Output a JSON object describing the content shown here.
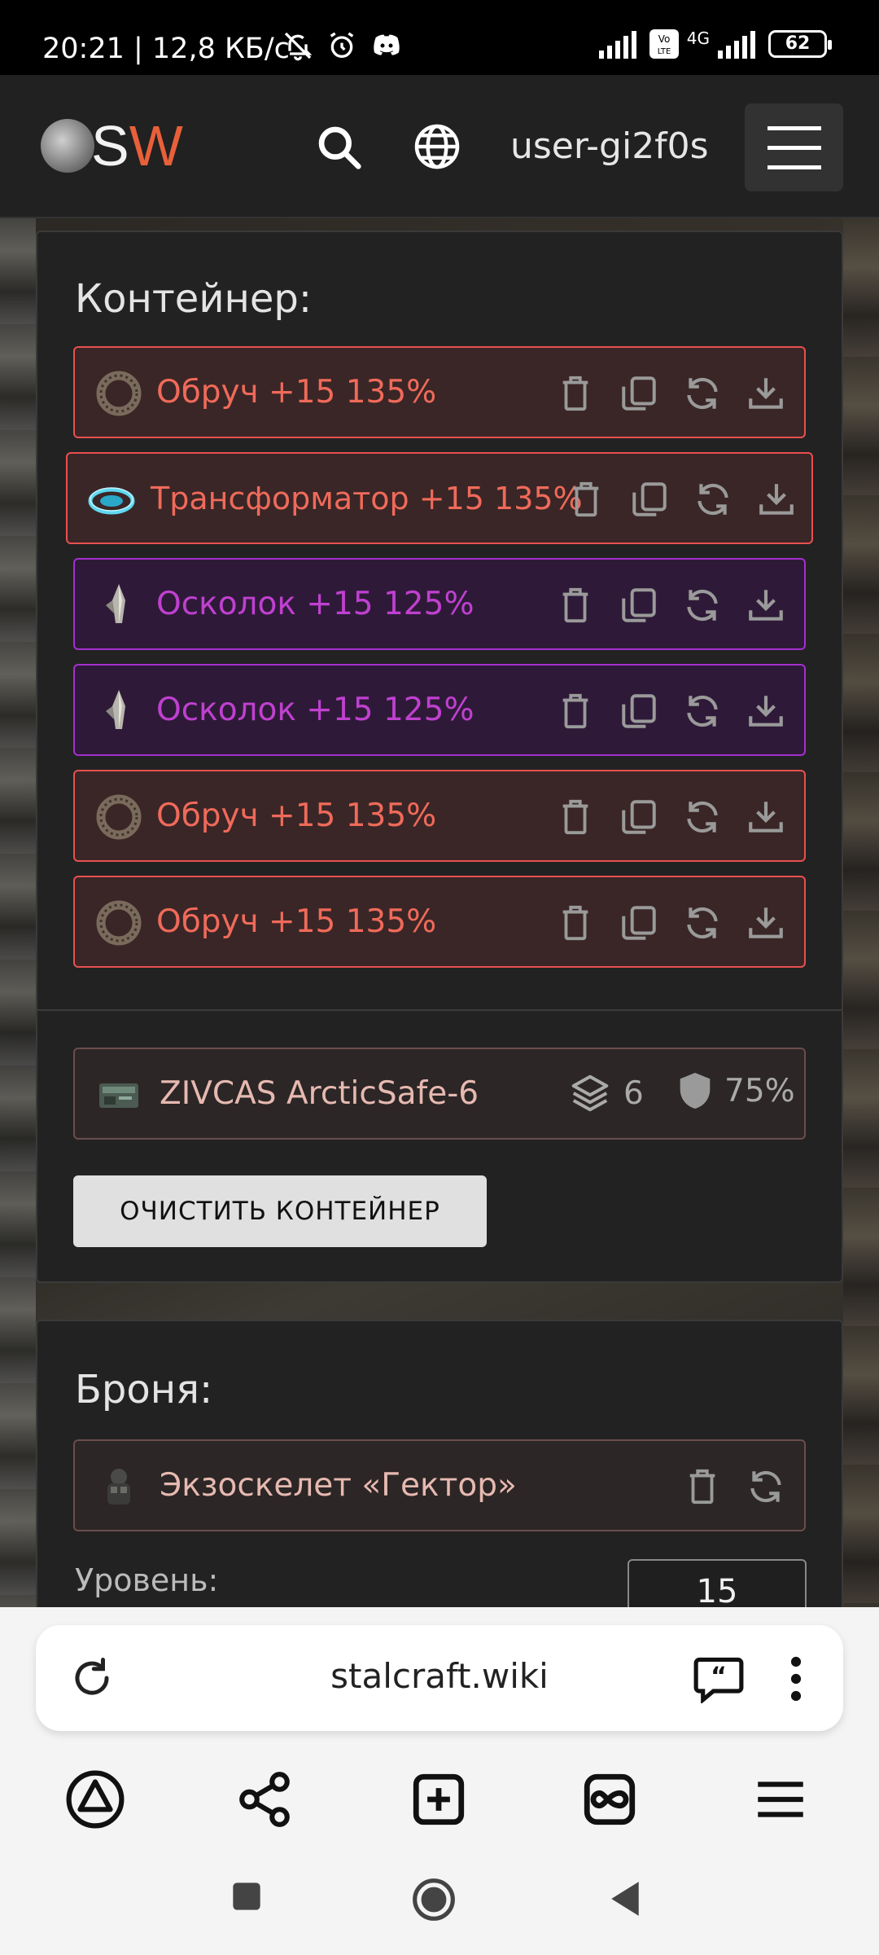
{
  "status_bar": {
    "time_speed": "20:21 | 12,8 КБ/с",
    "network": "4G",
    "battery": "62"
  },
  "header": {
    "logo_s": "S",
    "logo_w": "W",
    "username": "user-gi2f0s"
  },
  "container": {
    "title": "Контейнер:",
    "items": [
      {
        "label": "Обруч +15 135%",
        "rarity": "red",
        "icon": "ring-artifact-icon"
      },
      {
        "label": "Трансформатор +15 135%",
        "rarity": "red",
        "icon": "transformer-artifact-icon"
      },
      {
        "label": "Осколок +15 125%",
        "rarity": "purple",
        "icon": "shard-artifact-icon"
      },
      {
        "label": "Осколок +15 125%",
        "rarity": "purple",
        "icon": "shard-artifact-icon"
      },
      {
        "label": "Обруч +15 135%",
        "rarity": "red",
        "icon": "ring-artifact-icon"
      },
      {
        "label": "Обруч +15 135%",
        "rarity": "red",
        "icon": "ring-artifact-icon"
      }
    ],
    "case": {
      "name": "ZIVCAS ArcticSafe-6",
      "slots": "6",
      "protection": "75%"
    },
    "clear_button": "ОЧИСТИТЬ КОНТЕЙНЕР"
  },
  "armor": {
    "title": "Броня:",
    "item": "Экзоскелет «Гектор»",
    "level_label": "Уровень:",
    "level_value": "15"
  },
  "browser": {
    "url": "stalcraft.wiki"
  },
  "colors": {
    "rarity_red": "#e85050",
    "rarity_purple": "#a52fcf",
    "logo_accent": "#e8603a"
  }
}
